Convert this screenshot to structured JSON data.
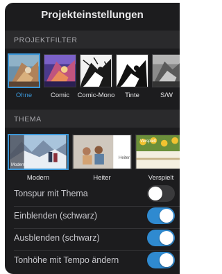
{
  "title": "Projekteinstellungen",
  "filter_section": {
    "header": "PROJEKTFILTER",
    "items": [
      {
        "label": "Ohne",
        "selected": true
      },
      {
        "label": "Comic",
        "selected": false
      },
      {
        "label": "Comic-Mono",
        "selected": false
      },
      {
        "label": "Tinte",
        "selected": false
      },
      {
        "label": "S/W",
        "selected": false
      }
    ]
  },
  "theme_section": {
    "header": "THEMA",
    "items": [
      {
        "label": "Modern",
        "thumb_text": "Modern",
        "selected": true
      },
      {
        "label": "Heiter",
        "thumb_text": "Heiter",
        "selected": false
      },
      {
        "label": "Verspielt",
        "thumb_text": "Verspielt",
        "selected": false
      }
    ]
  },
  "settings": [
    {
      "label": "Tonspur mit Thema",
      "on": false
    },
    {
      "label": "Einblenden (schwarz)",
      "on": true
    },
    {
      "label": "Ausblenden (schwarz)",
      "on": true
    },
    {
      "label": "Tonhöhe mit Tempo ändern",
      "on": true
    }
  ],
  "colors": {
    "panel": "#1c1c1e",
    "accent": "#3a96d8",
    "toggle_on": "#2f8ad0",
    "toggle_off": "#3a3a3c"
  }
}
